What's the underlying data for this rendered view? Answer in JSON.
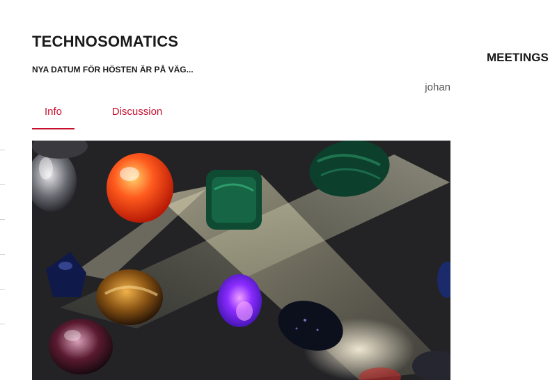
{
  "page": {
    "title": "TECHNOSOMATICS",
    "subtitle": "NYA DATUM FÖR HÖSTEN ÄR PÅ VÄG...",
    "author": "johan"
  },
  "sidebar": {
    "heading": "MEETINGS"
  },
  "tabs": [
    {
      "label": "Info",
      "active": true
    },
    {
      "label": "Discussion",
      "active": false
    }
  ],
  "colors": {
    "accent": "#c8102e",
    "text": "#1a1a1a",
    "muted": "#555555"
  },
  "hero_image": {
    "subject": "polished gemstones under colored light",
    "icon": "photo"
  }
}
